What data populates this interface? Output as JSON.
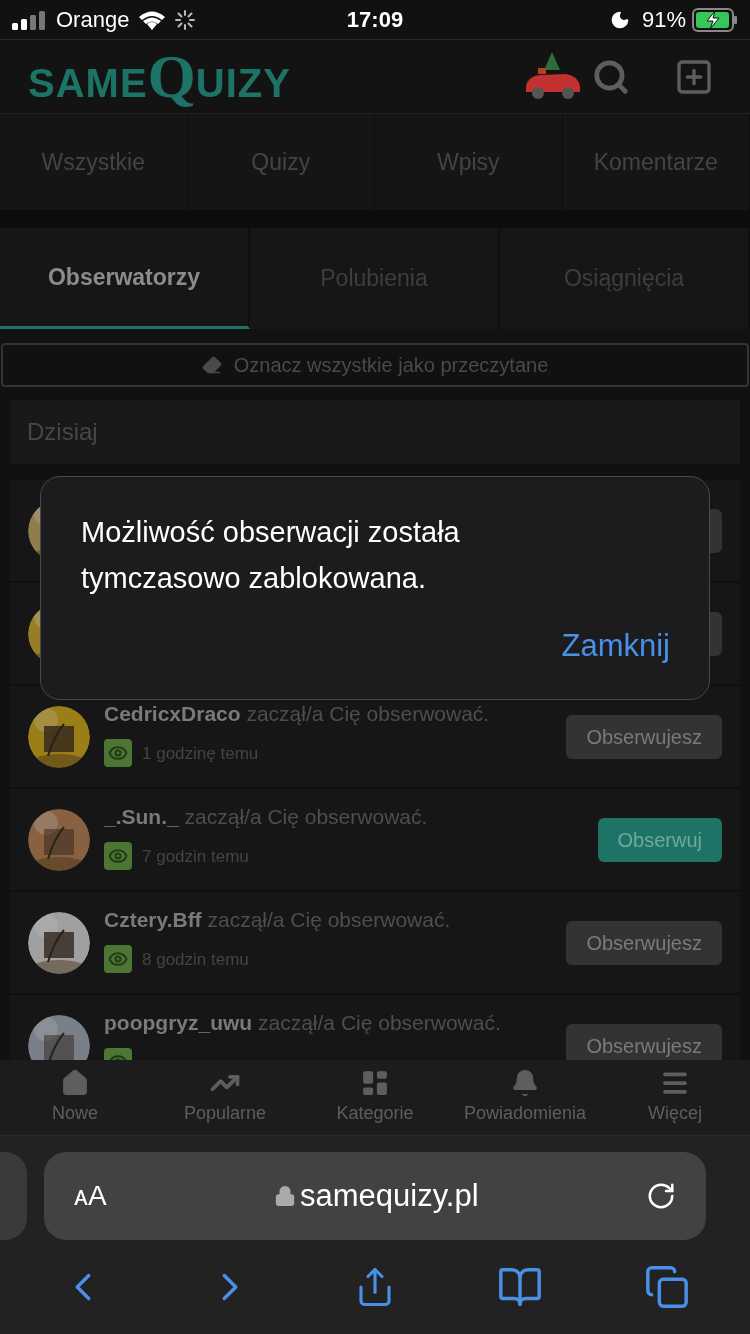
{
  "status_bar": {
    "carrier": "Orange",
    "time": "17:09",
    "battery": "91%"
  },
  "header": {
    "logo": [
      "SAME",
      "Q",
      "UIZY"
    ]
  },
  "nav_tabs": [
    {
      "label": "Wszystkie",
      "selected": false
    },
    {
      "label": "Quizy",
      "selected": false
    },
    {
      "label": "Wpisy",
      "selected": false
    },
    {
      "label": "Komentarze",
      "selected": false
    }
  ],
  "sub_tabs": [
    {
      "label": "Obserwatorzy",
      "selected": true
    },
    {
      "label": "Polubienia",
      "selected": false
    },
    {
      "label": "Osiągnięcia",
      "selected": false
    }
  ],
  "mark_all_button": "Oznacz wszystkie jako przeczytane",
  "section_title": "Dzisiaj",
  "notifications": [
    {
      "user": "CedricxDraco",
      "action": "zaczął/a Cię obserwować.",
      "time": "1 godzinę temu",
      "button": {
        "label": "Obserwujesz",
        "kind": "following"
      }
    },
    {
      "user": "_.Sun._",
      "action": "zaczął/a Cię obserwować.",
      "time": "7 godzin temu",
      "button": {
        "label": "Obserwuj",
        "kind": "follow"
      }
    },
    {
      "user": "Cztery.Bff",
      "action": "zaczął/a Cię obserwować.",
      "time": "8 godzin temu",
      "button": {
        "label": "Obserwujesz",
        "kind": "following"
      }
    },
    {
      "user": "poopgryz_uwu",
      "action": "zaczął/a Cię obserwować.",
      "button": {
        "label": "Obserwujesz",
        "kind": "following"
      }
    }
  ],
  "bottom_nav": [
    {
      "label": "Nowe",
      "selected": false
    },
    {
      "label": "Popularne",
      "selected": false
    },
    {
      "label": "Kategorie",
      "selected": false
    },
    {
      "label": "Powiadomienia",
      "selected": false
    },
    {
      "label": "Więcej",
      "selected": false
    }
  ],
  "dialog": {
    "message": "Możliwość obserwacji została tymczasowo zablokowana.",
    "button": "Zamknij"
  },
  "browser": {
    "text_size_button": "ᴀA",
    "url": "samequizy.pl"
  }
}
